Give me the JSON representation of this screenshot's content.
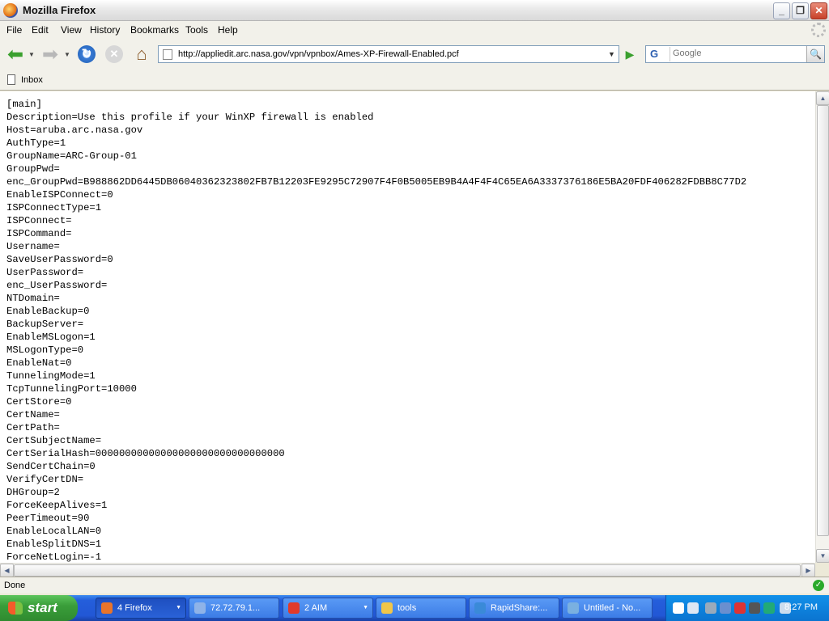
{
  "window": {
    "title": "Mozilla Firefox"
  },
  "menu": [
    "File",
    "Edit",
    "View",
    "History",
    "Bookmarks",
    "Tools",
    "Help"
  ],
  "nav": {
    "url": "http://appliedit.arc.nasa.gov/vpn/vpnbox/Ames-XP-Firewall-Enabled.pcf",
    "search_placeholder": "Google",
    "search_engine_icon": "G"
  },
  "bookmarks": [
    {
      "label": "Inbox"
    }
  ],
  "content": {
    "lines": [
      "[main]",
      "Description=Use this profile if your WinXP firewall is enabled",
      "Host=aruba.arc.nasa.gov",
      "AuthType=1",
      "GroupName=ARC-Group-01",
      "GroupPwd=",
      "enc_GroupPwd=B988862DD6445DB06040362323802FB7B12203FE9295C72907F4F0B5005EB9B4A4F4F4C65EA6A3337376186E5BA20FDF406282FDBB8C77D2",
      "EnableISPConnect=0",
      "ISPConnectType=1",
      "ISPConnect=",
      "ISPCommand=",
      "Username=",
      "SaveUserPassword=0",
      "UserPassword=",
      "enc_UserPassword=",
      "NTDomain=",
      "EnableBackup=0",
      "BackupServer=",
      "EnableMSLogon=1",
      "MSLogonType=0",
      "EnableNat=0",
      "TunnelingMode=1",
      "TcpTunnelingPort=10000",
      "CertStore=0",
      "CertName=",
      "CertPath=",
      "CertSubjectName=",
      "CertSerialHash=00000000000000000000000000000000",
      "SendCertChain=0",
      "VerifyCertDN=",
      "DHGroup=2",
      "ForceKeepAlives=1",
      "PeerTimeout=90",
      "EnableLocalLAN=0",
      "EnableSplitDNS=1",
      "ForceNetLogin=-1"
    ]
  },
  "status": {
    "text": "Done"
  },
  "taskbar": {
    "start_label": "start",
    "tasks": [
      {
        "label": "4 Firefox",
        "active": true,
        "icon_color": "#e8742a"
      },
      {
        "label": "72.72.79.1...",
        "active": false,
        "icon_color": "#8fb3e8"
      },
      {
        "label": "2 AIM",
        "active": false,
        "icon_color": "#e23a2a"
      },
      {
        "label": "tools",
        "active": false,
        "icon_color": "#f0c64a"
      },
      {
        "label": "RapidShare:...",
        "active": false,
        "icon_color": "#3a8ad8"
      },
      {
        "label": "Untitled - No...",
        "active": false,
        "icon_color": "#7ab0e0"
      }
    ],
    "clock": "8:27 PM"
  },
  "colors": {
    "accent_blue": "#245edb",
    "start_green": "#3a9e3a",
    "go_green": "#3aa02e"
  }
}
